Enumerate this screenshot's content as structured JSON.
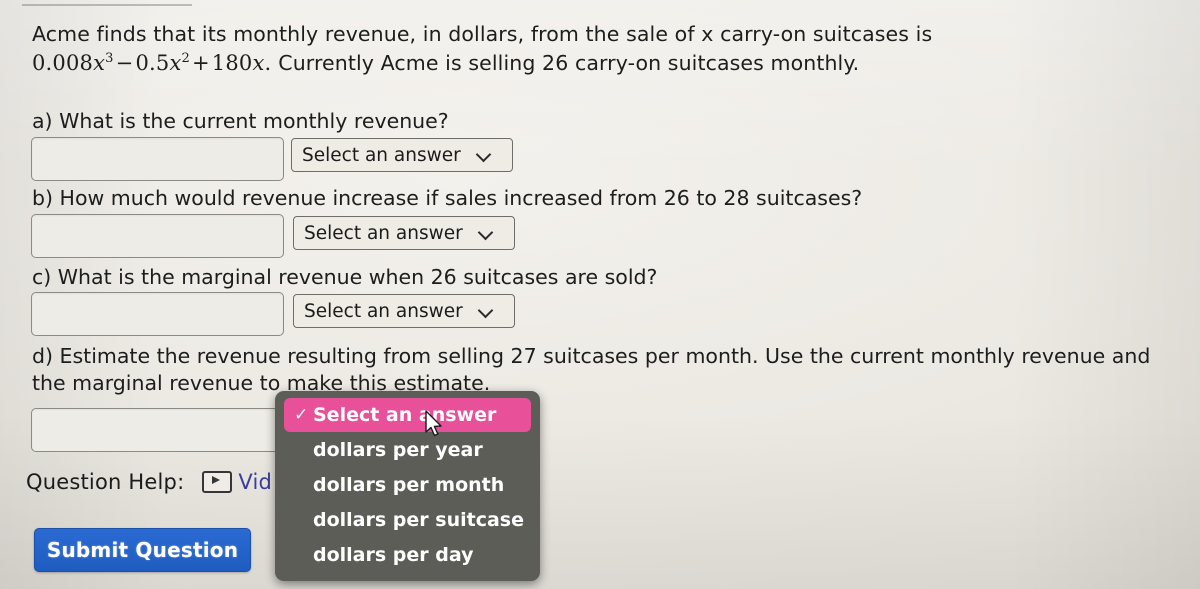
{
  "problem": {
    "line1": "Acme finds that its monthly revenue, in dollars, from the sale of x carry-on suitcases is",
    "formula_plain": "0.008x³ − 0.5x² + 180x.",
    "formula_parts": {
      "t1_coef": "0.008",
      "t1_var": "x",
      "t1_pow": "3",
      "op1": "−",
      "t2_coef": "0.5",
      "t2_var": "x",
      "t2_pow": "2",
      "op2": "+",
      "t3_coef": "180",
      "t3_var": "x",
      "period": "."
    },
    "line2_tail": "Currently Acme is selling 26 carry-on suitcases monthly."
  },
  "questions": {
    "a": {
      "text": "a) What is the current monthly revenue?",
      "input_value": "",
      "select_label": "Select an answer"
    },
    "b": {
      "text": "b) How much would revenue increase if sales increased from 26 to 28 suitcases?",
      "input_value": "",
      "select_label": "Select an answer"
    },
    "c": {
      "text": "c) What is the marginal revenue when 26 suitcases are sold?",
      "input_value": "",
      "select_label": "Select an answer"
    },
    "d": {
      "text": "d) Estimate the revenue resulting from selling 27 suitcases per month. Use the current monthly revenue and the marginal revenue to make this estimate.",
      "input_value": ""
    }
  },
  "help": {
    "label": "Question Help:",
    "video_link_text": "Vid",
    "video_icon": "video-play-icon"
  },
  "submit": {
    "label": "Submit Question"
  },
  "dropdown": {
    "open": true,
    "items": [
      {
        "label": "Select an answer",
        "selected": true
      },
      {
        "label": "dollars per year",
        "selected": false
      },
      {
        "label": "dollars per month",
        "selected": false
      },
      {
        "label": "dollars per suitcase",
        "selected": false
      },
      {
        "label": "dollars per day",
        "selected": false
      }
    ],
    "check_glyph": "✓"
  },
  "colors": {
    "page_background": "#ece9e3",
    "dropdown_background": "#5d5d57",
    "dropdown_highlight": "#e8509a",
    "submit_button": "#1f5cc0",
    "link": "#3c3c9e",
    "text": "#1d1d1d"
  }
}
